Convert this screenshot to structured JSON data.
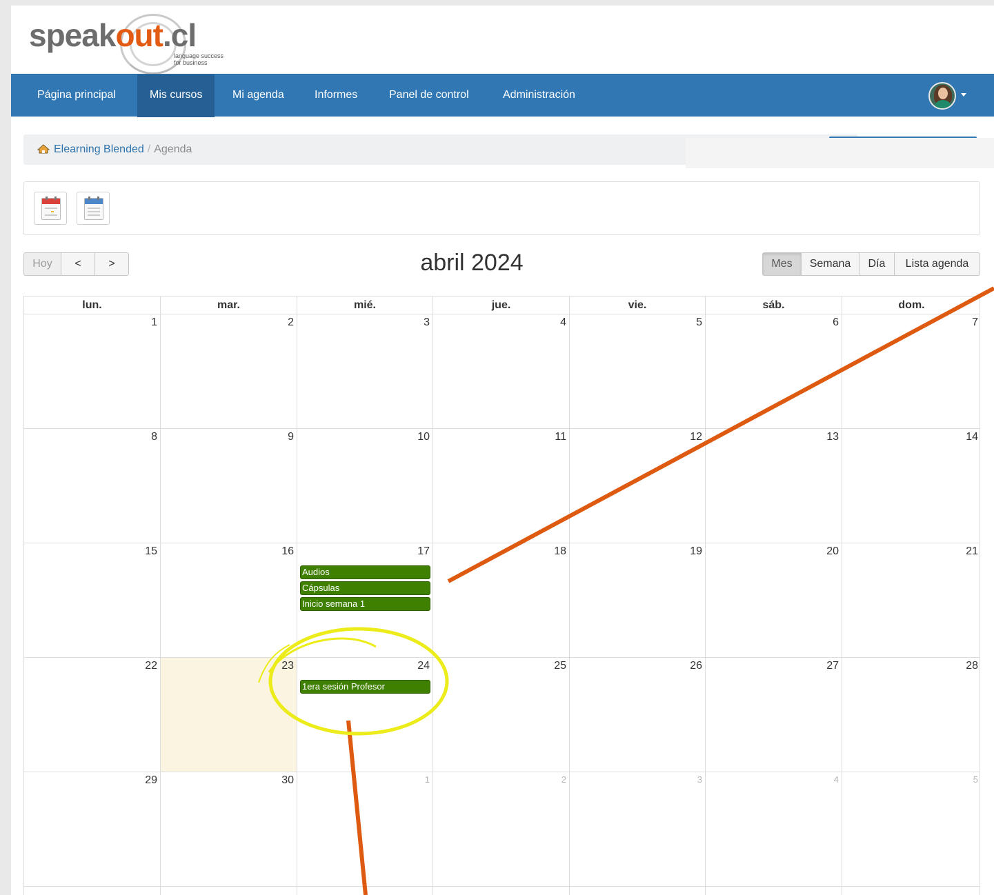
{
  "logo": {
    "text_a": "speak",
    "text_b": "out",
    "text_c": ".cl",
    "tagline_1": "language success",
    "tagline_2": "for business"
  },
  "nav": {
    "items": [
      {
        "label": "Página principal"
      },
      {
        "label": "Mis cursos",
        "active": true
      },
      {
        "label": "Mi agenda"
      },
      {
        "label": "Informes"
      },
      {
        "label": "Panel de control"
      },
      {
        "label": "Administración"
      }
    ],
    "user_menu_icon": "avatar-icon"
  },
  "breadcrumb": {
    "home": "Elearning Blended",
    "separator": "/",
    "current": "Agenda"
  },
  "toolbar_icons": [
    "month-calendar-icon",
    "list-calendar-icon"
  ],
  "calendar": {
    "title": "abril 2024",
    "today_button": "Hoy",
    "prev_icon": "<",
    "next_icon": ">",
    "views": [
      {
        "label": "Mes",
        "active": true
      },
      {
        "label": "Semana"
      },
      {
        "label": "Día"
      },
      {
        "label": "Lista agenda"
      }
    ],
    "weekdays": [
      "lun.",
      "mar.",
      "mié.",
      "jue.",
      "vie.",
      "sáb.",
      "dom."
    ],
    "weeks": [
      [
        "1",
        "2",
        "3",
        "4",
        "5",
        "6",
        "7"
      ],
      [
        "8",
        "9",
        "10",
        "11",
        "12",
        "13",
        "14"
      ],
      [
        "15",
        "16",
        "17",
        "18",
        "19",
        "20",
        "21"
      ],
      [
        "22",
        "23",
        "24",
        "25",
        "26",
        "27",
        "28"
      ],
      [
        "29",
        "30",
        "1",
        "2",
        "3",
        "4",
        "5"
      ]
    ],
    "other_month": [
      [
        4,
        2
      ],
      [
        4,
        3
      ],
      [
        4,
        4
      ],
      [
        4,
        5
      ],
      [
        4,
        6
      ]
    ],
    "today": [
      3,
      1
    ],
    "events": [
      {
        "week": 2,
        "day": 2,
        "slot": 0,
        "title": "Audios"
      },
      {
        "week": 2,
        "day": 2,
        "slot": 1,
        "title": "Cápsulas"
      },
      {
        "week": 2,
        "day": 2,
        "slot": 2,
        "title": "Inicio semana 1"
      },
      {
        "week": 3,
        "day": 2,
        "slot": 0,
        "title": "1era sesión Profesor"
      }
    ],
    "event_color": "#408000",
    "today_color": "#faf4e1"
  },
  "colors": {
    "navbar": "#3077b4",
    "accent": "#e35b12",
    "annotation_arrow": "#dd5a10",
    "annotation_circle": "#ecec1a"
  }
}
